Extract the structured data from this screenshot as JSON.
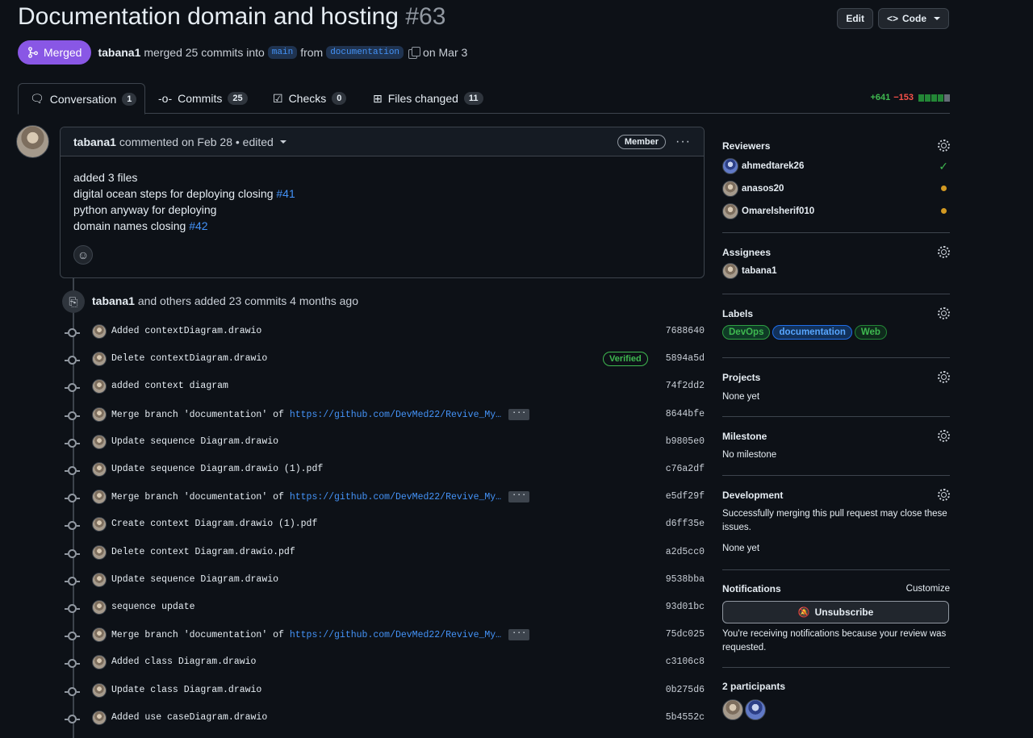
{
  "header": {
    "title": "Documentation domain and hosting",
    "number": "#63",
    "edit_label": "Edit",
    "code_label": "Code",
    "state_label": "Merged",
    "author": "tabana1",
    "merge_text": "merged 25 commits into",
    "base_branch": "main",
    "from_text": "from",
    "head_branch": "documentation",
    "date_text": "on Mar 3"
  },
  "tabs": [
    {
      "label": "Conversation",
      "count": "1"
    },
    {
      "label": "Commits",
      "count": "25"
    },
    {
      "label": "Checks",
      "count": "0"
    },
    {
      "label": "Files changed",
      "count": "11"
    }
  ],
  "diffstat": {
    "additions": "+641",
    "deletions": "−153"
  },
  "comment": {
    "author": "tabana1",
    "action": "commented on Feb 28 • edited",
    "badge": "Member",
    "lines": [
      {
        "text": "added 3 files",
        "link": ""
      },
      {
        "text": "digital ocean steps for deploying closing ",
        "link": "#41"
      },
      {
        "text": "python anyway for deploying",
        "link": ""
      },
      {
        "text": "domain names closing ",
        "link": "#42"
      }
    ]
  },
  "commits_summary": {
    "author": "tabana1",
    "text": "and others added 23 commits 4 months ago"
  },
  "commits": [
    {
      "msg": "Added contextDiagram.drawio",
      "link": "",
      "sha": "7688640",
      "verified": ""
    },
    {
      "msg": "Delete contextDiagram.drawio",
      "link": "",
      "sha": "5894a5d",
      "verified": "Verified"
    },
    {
      "msg": "added context diagram",
      "link": "",
      "sha": "74f2dd2",
      "verified": ""
    },
    {
      "msg": "Merge branch 'documentation' of ",
      "link": "https://github.com/DevMed22/Revive_My…",
      "sha": "8644bfe",
      "verified": ""
    },
    {
      "msg": "Update sequence Diagram.drawio",
      "link": "",
      "sha": "b9805e0",
      "verified": ""
    },
    {
      "msg": "Update sequence Diagram.drawio (1).pdf",
      "link": "",
      "sha": "c76a2df",
      "verified": ""
    },
    {
      "msg": "Merge branch 'documentation' of ",
      "link": "https://github.com/DevMed22/Revive_My…",
      "sha": "e5df29f",
      "verified": ""
    },
    {
      "msg": "Create context Diagram.drawio (1).pdf",
      "link": "",
      "sha": "d6ff35e",
      "verified": ""
    },
    {
      "msg": "Delete context Diagram.drawio.pdf",
      "link": "",
      "sha": "a2d5cc0",
      "verified": ""
    },
    {
      "msg": "Update sequence Diagram.drawio",
      "link": "",
      "sha": "9538bba",
      "verified": ""
    },
    {
      "msg": "sequence update",
      "link": "",
      "sha": "93d01bc",
      "verified": ""
    },
    {
      "msg": "Merge branch 'documentation' of ",
      "link": "https://github.com/DevMed22/Revive_My…",
      "sha": "75dc025",
      "verified": ""
    },
    {
      "msg": "Added class Diagram.drawio",
      "link": "",
      "sha": "c3106c8",
      "verified": ""
    },
    {
      "msg": "Update class Diagram.drawio",
      "link": "",
      "sha": "0b275d6",
      "verified": ""
    },
    {
      "msg": "Added use caseDiagram.drawio",
      "link": "",
      "sha": "5b4552c",
      "verified": ""
    }
  ],
  "sidebar": {
    "reviewers": {
      "title": "Reviewers",
      "people": [
        {
          "name": "ahmedtarek26",
          "status": "approved"
        },
        {
          "name": "anasos20",
          "status": "pending"
        },
        {
          "name": "Omarelsherif010",
          "status": "pending"
        }
      ]
    },
    "assignees": {
      "title": "Assignees",
      "people": [
        {
          "name": "tabana1"
        }
      ]
    },
    "labels": {
      "title": "Labels",
      "items": [
        {
          "name": "DevOps",
          "fg": "#3fb950",
          "bg": "#0f3a26",
          "border": "#2ea043"
        },
        {
          "name": "documentation",
          "fg": "#58a6ff",
          "bg": "#12315a",
          "border": "#1f6feb"
        },
        {
          "name": "Web",
          "fg": "#3fb950",
          "bg": "#0f2a1c",
          "border": "#238636"
        }
      ]
    },
    "projects": {
      "title": "Projects",
      "value": "None yet"
    },
    "milestone": {
      "title": "Milestone",
      "value": "No milestone"
    },
    "development": {
      "title": "Development",
      "desc": "Successfully merging this pull request may close these issues.",
      "value": "None yet"
    },
    "notifications": {
      "title": "Notifications",
      "customize": "Customize",
      "button": "Unsubscribe",
      "reason": "You're receiving notifications because your review was requested."
    },
    "participants": {
      "title": "2 participants"
    }
  }
}
